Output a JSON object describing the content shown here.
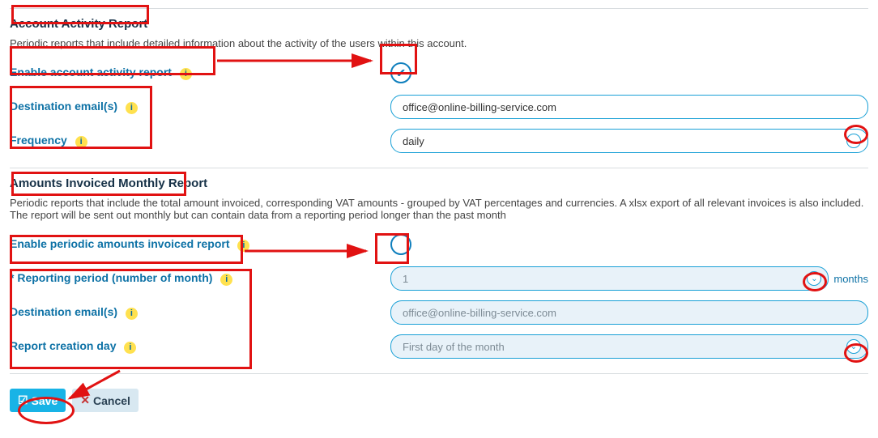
{
  "section1": {
    "title": "Account Activity Report",
    "desc": "Periodic reports that include detailed information about the activity of the users within this account.",
    "enable_label": "Enable account activity report",
    "dest_label": "Destination email(s)",
    "dest_value": "office@online-billing-service.com",
    "freq_label": "Frequency",
    "freq_value": "daily"
  },
  "section2": {
    "title": "Amounts Invoiced Monthly Report",
    "desc": "Periodic reports that include the total amount invoiced, corresponding VAT amounts - grouped by VAT percentages and currencies. A xlsx export of all relevant invoices is also included. The report will be sent out monthly but can contain data from a reporting period longer than the past month",
    "enable_label": "Enable periodic amounts invoiced report",
    "period_label": "* Reporting period (number of month)",
    "period_value": "1",
    "period_unit": "months",
    "dest_label": "Destination email(s)",
    "dest_value": "office@online-billing-service.com",
    "day_label": "Report creation day",
    "day_value": "First day of the month"
  },
  "buttons": {
    "save": "Save",
    "cancel": "Cancel"
  },
  "info_glyph": "i",
  "caret_glyph": "⌄",
  "save_glyph": "☑",
  "cancel_glyph": "✕"
}
